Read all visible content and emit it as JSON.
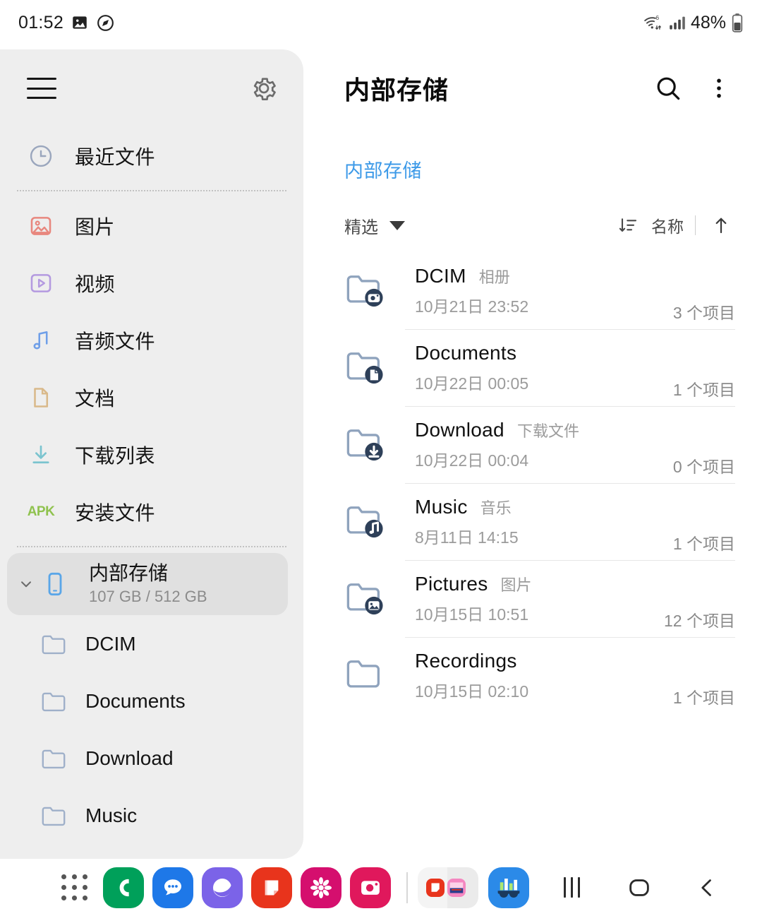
{
  "status_bar": {
    "time": "01:52",
    "battery_percent": "48%",
    "icons": [
      "screenshot-icon",
      "speed-boost-icon",
      "wifi-6-icon",
      "signal-bars-icon",
      "battery-icon"
    ]
  },
  "sidebar": {
    "menu_icon": "hamburger-menu-icon",
    "settings_icon": "gear-icon",
    "categories": [
      {
        "label": "最近文件",
        "icon": "clock-icon",
        "color": "#9aa6bd"
      },
      {
        "label": "图片",
        "icon": "image-icon",
        "color": "#e8877e"
      },
      {
        "label": "视频",
        "icon": "video-icon",
        "color": "#b49ae0"
      },
      {
        "label": "音频文件",
        "icon": "music-note-icon",
        "color": "#6f9fe8"
      },
      {
        "label": "文档",
        "icon": "document-icon",
        "color": "#d9b98a"
      },
      {
        "label": "下载列表",
        "icon": "download-icon",
        "color": "#7bc4cf"
      },
      {
        "label": "安装文件",
        "icon": "apk-icon",
        "color": "#8fc24e"
      }
    ],
    "storage": {
      "label": "内部存储",
      "usage": "107 GB / 512 GB",
      "expand_icon": "chevron-down-icon",
      "device_icon": "phone-icon"
    },
    "subfolders": [
      {
        "label": "DCIM",
        "icon": "folder-icon"
      },
      {
        "label": "Documents",
        "icon": "folder-icon"
      },
      {
        "label": "Download",
        "icon": "folder-icon"
      },
      {
        "label": "Music",
        "icon": "folder-icon"
      }
    ]
  },
  "main": {
    "title": "内部存储",
    "search_icon": "search-icon",
    "more_icon": "more-vertical-icon",
    "breadcrumb": "内部存储",
    "breadcrumb_color": "#3d9ae8",
    "sort": {
      "filter_label": "精选",
      "filter_caret": "caret-down-icon",
      "sort_icon": "sort-descending-icon",
      "sort_label": "名称",
      "direction_icon": "arrow-up-icon"
    },
    "files": [
      {
        "name": "DCIM",
        "alias": "相册",
        "date": "10月21日 23:52",
        "count": "3 个项目",
        "icon": "folder-camera-icon"
      },
      {
        "name": "Documents",
        "alias": "",
        "date": "10月22日 00:05",
        "count": "1 个项目",
        "icon": "folder-document-icon"
      },
      {
        "name": "Download",
        "alias": "下载文件",
        "date": "10月22日 00:04",
        "count": "0 个项目",
        "icon": "folder-download-icon"
      },
      {
        "name": "Music",
        "alias": "音乐",
        "date": "8月11日 14:15",
        "count": "1 个项目",
        "icon": "folder-music-icon"
      },
      {
        "name": "Pictures",
        "alias": "图片",
        "date": "10月15日 10:51",
        "count": "12 个项目",
        "icon": "folder-image-icon"
      },
      {
        "name": "Recordings",
        "alias": "",
        "date": "10月15日 02:10",
        "count": "1 个项目",
        "icon": "folder-icon"
      }
    ]
  },
  "dock": {
    "apps": [
      {
        "name": "app-drawer-button",
        "icon": "grid-dots-icon",
        "color": "#ffffff"
      },
      {
        "name": "phone-app",
        "icon": "phone-icon",
        "color": "#00a05a"
      },
      {
        "name": "messages-app",
        "icon": "chat-bubble-icon",
        "color": "#1e78e8"
      },
      {
        "name": "internet-app",
        "icon": "browser-icon",
        "color": "#7b63e8"
      },
      {
        "name": "notes-app",
        "icon": "note-icon",
        "color": "#e8341c"
      },
      {
        "name": "gallery-app",
        "icon": "flower-icon",
        "color": "#d50f6e"
      },
      {
        "name": "camera-app",
        "icon": "camera-icon",
        "color": "#e0185c"
      }
    ],
    "recent_pair": [
      "note-icon",
      "pink-app-icon"
    ],
    "assistant_app": {
      "name": "data-glasses-app",
      "icon": "glasses-chart-icon",
      "color": "#2b8ae8"
    },
    "nav": [
      {
        "name": "recents-button",
        "icon": "recents-bars-icon"
      },
      {
        "name": "home-button",
        "icon": "home-square-icon"
      },
      {
        "name": "back-button",
        "icon": "back-chevron-icon"
      }
    ]
  }
}
